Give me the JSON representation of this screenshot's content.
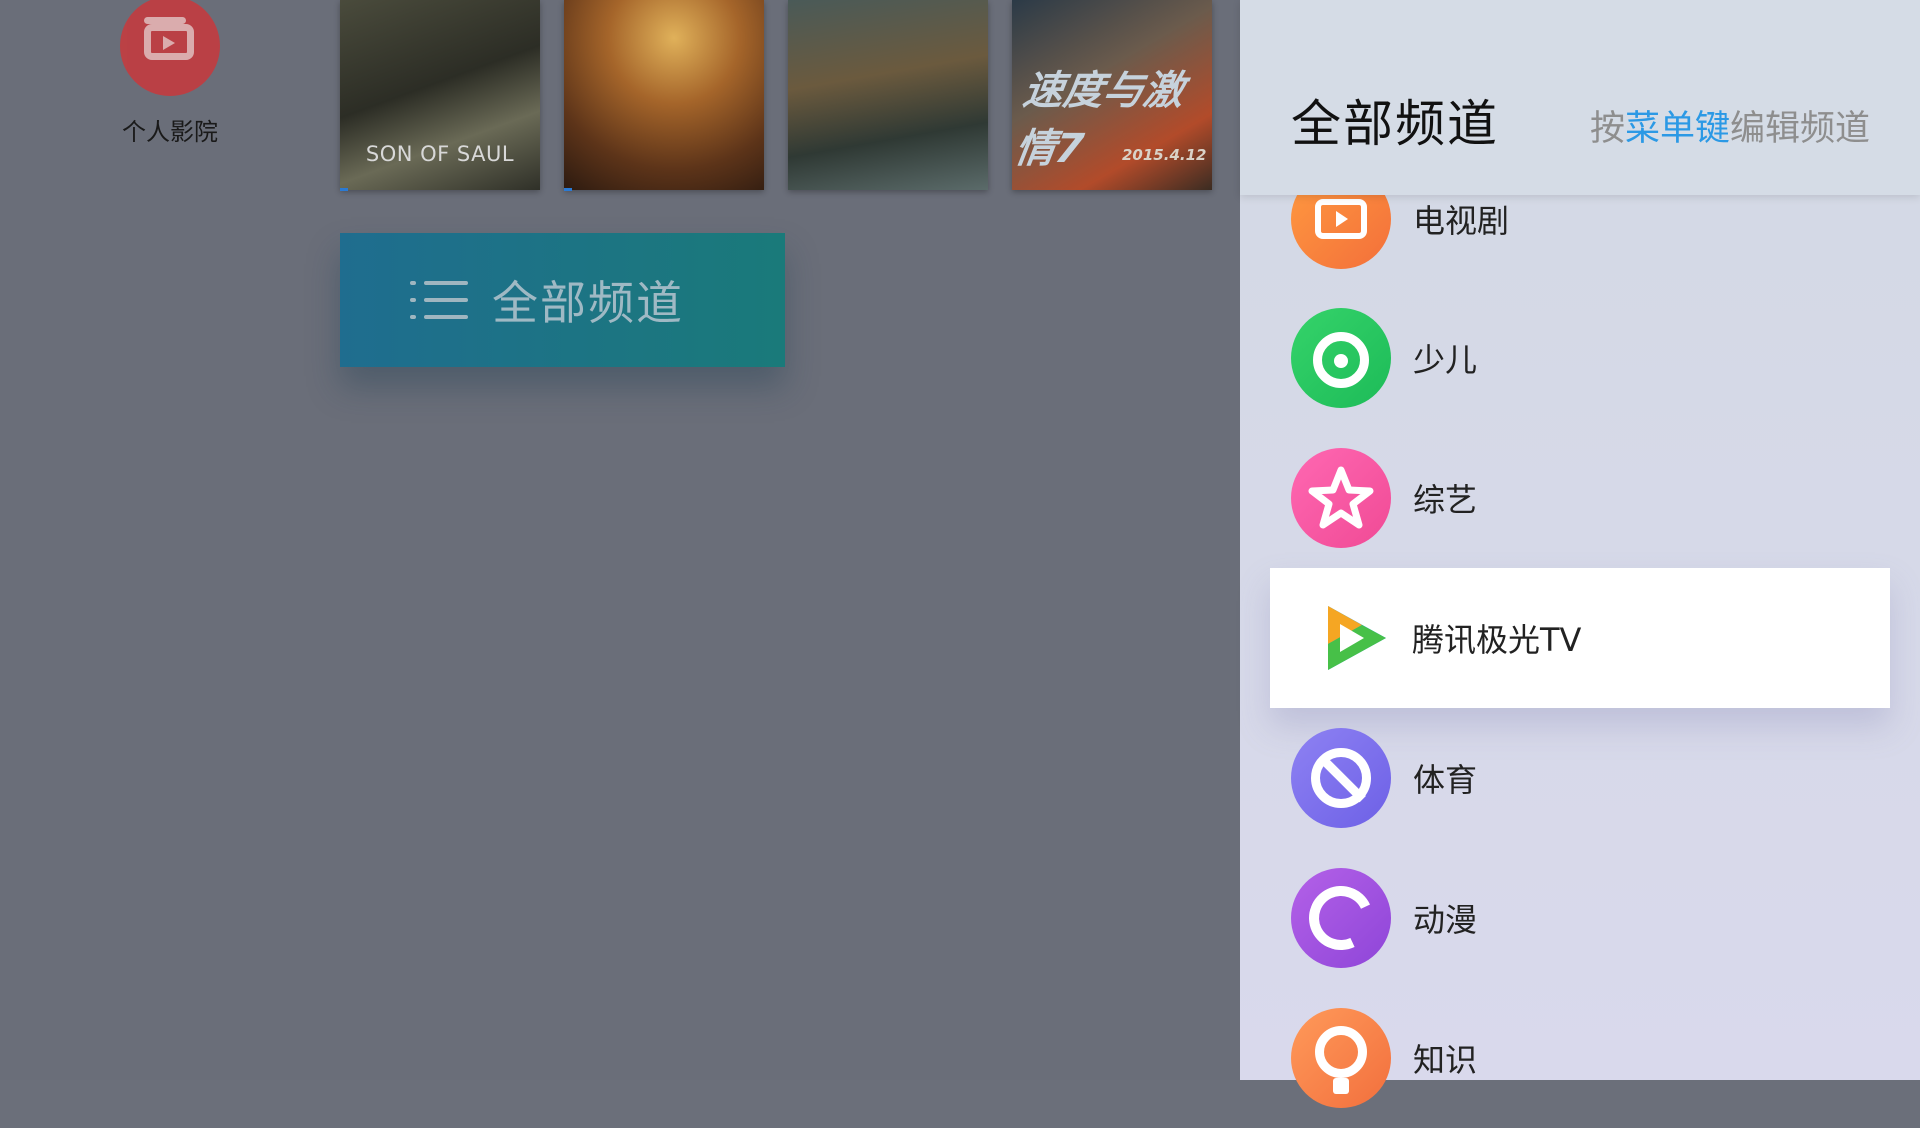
{
  "home": {
    "personal_cinema_label": "个人影院",
    "posters": [
      {
        "title": "SON OF SAUL"
      },
      {
        "title": ""
      },
      {
        "title": ""
      },
      {
        "title": "速度与激情7",
        "subtitle": "2015.4.12"
      }
    ],
    "all_channels_button": "全部频道"
  },
  "panel": {
    "title": "全部频道",
    "hint_prefix": "按",
    "hint_key": "菜单键",
    "hint_suffix": "编辑频道",
    "channels": [
      {
        "label": "电视剧",
        "icon": "tv-icon",
        "color": "#f57f3a"
      },
      {
        "label": "少儿",
        "icon": "kids-icon",
        "color": "#21c35e"
      },
      {
        "label": "综艺",
        "icon": "star-icon",
        "color": "#f2559e"
      },
      {
        "label": "腾讯极光TV",
        "icon": "tencent-video-icon",
        "active": true
      },
      {
        "label": "体育",
        "icon": "sports-icon",
        "color": "#7568ea"
      },
      {
        "label": "动漫",
        "icon": "anime-icon",
        "color": "#9a4ddc"
      },
      {
        "label": "知识",
        "icon": "knowledge-icon",
        "color": "#f47840"
      }
    ]
  },
  "colors": {
    "hint_highlight": "#2b99e5",
    "button_gradient_start": "#1f6d8f",
    "button_gradient_end": "#1a7a7a"
  }
}
